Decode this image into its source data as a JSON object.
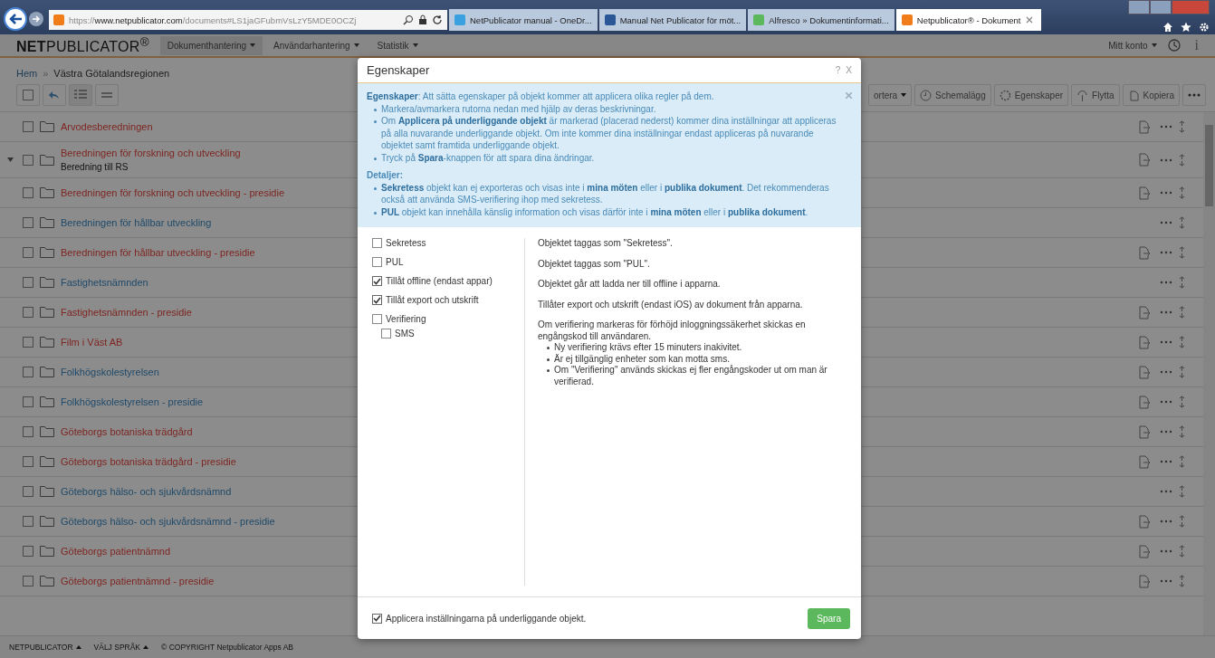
{
  "browser": {
    "address": {
      "scheme": "https://",
      "domain": "www.netpublicator.com",
      "path": "/documents#LS1jaGFubmVsLzY5MDE0OCZj"
    },
    "tabs": [
      {
        "title": "NetPublicator manual - OneDr...",
        "kind": "globe",
        "selected": false
      },
      {
        "title": "Manual Net Publicator för möt...",
        "kind": "word",
        "selected": false
      },
      {
        "title": "Alfresco » Dokumentinformati...",
        "kind": "flower",
        "selected": false
      },
      {
        "title": "Netpublicator® - Dokument",
        "kind": "site",
        "selected": true
      }
    ]
  },
  "nav": {
    "logo": "**NET**PUBLICATOR$^{®}$",
    "menu": [
      {
        "label": "Dokumenthantering",
        "selected": true
      },
      {
        "label": "Användarhantering",
        "selected": false
      },
      {
        "label": "Statistik",
        "selected": false
      }
    ],
    "account": "Mitt konto",
    "info": "i"
  },
  "breadcrumb": {
    "home": "Hem",
    "separator": "»",
    "current": "Västra Götalandsregionen"
  },
  "toolbar": [
    {
      "label": "ortera",
      "kind": "dropdown"
    },
    {
      "label": "Schemalägg",
      "kind": "clock"
    },
    {
      "label": "Egenskaper",
      "kind": "gear"
    },
    {
      "label": "Flytta",
      "kind": "move"
    },
    {
      "label": "Kopiera",
      "kind": "copy"
    }
  ],
  "rows": [
    {
      "title": "Arvodesberedningen",
      "color": "#7e2622",
      "checked": false,
      "expanded": false,
      "document_icon": true
    },
    {
      "title": "Beredningen för forskning och utveckling",
      "subtitle": "Beredning till RS",
      "color": "#7e2622",
      "checked": false,
      "expanded": true,
      "document_icon": true
    },
    {
      "title": "Beredningen för forskning och utveckling - presidie",
      "color": "#7e2622",
      "checked": false,
      "expanded": false,
      "document_icon": true
    },
    {
      "title": "Beredningen för hållbar utveckling",
      "color": "#1f4a6a",
      "checked": false,
      "expanded": false,
      "document_icon": false
    },
    {
      "title": "Beredningen för hållbar utveckling - presidie",
      "color": "#7e2622",
      "checked": false,
      "expanded": false,
      "document_icon": true
    },
    {
      "title": "Fastighetsnämnden",
      "color": "#1f4a6a",
      "checked": false,
      "expanded": false,
      "document_icon": false
    },
    {
      "title": "Fastighetsnämnden - presidie",
      "color": "#7e2622",
      "checked": false,
      "expanded": false,
      "document_icon": true
    },
    {
      "title": "Film i Väst AB",
      "color": "#7e2622",
      "checked": false,
      "expanded": false,
      "document_icon": true
    },
    {
      "title": "Folkhögskolestyrelsen",
      "color": "#1f4a6a",
      "checked": false,
      "expanded": false,
      "document_icon": true
    },
    {
      "title": "Folkhögskolestyrelsen - presidie",
      "color": "#1f4a6a",
      "checked": false,
      "expanded": false,
      "document_icon": true
    },
    {
      "title": "Göteborgs botaniska trädgård",
      "color": "#7e2622",
      "checked": false,
      "expanded": false,
      "document_icon": true
    },
    {
      "title": "Göteborgs botaniska trädgård - presidie",
      "color": "#7e2622",
      "checked": false,
      "expanded": false,
      "document_icon": true
    },
    {
      "title": "Göteborgs hälso- och sjukvårdsnämnd",
      "color": "#1f4a6a",
      "checked": false,
      "expanded": false,
      "document_icon": false
    },
    {
      "title": "Göteborgs hälso- och sjukvårdsnämnd - presidie",
      "color": "#1f4a6a",
      "checked": false,
      "expanded": false,
      "document_icon": true
    },
    {
      "title": "Göteborgs patientnämnd",
      "color": "#7e2622",
      "checked": false,
      "expanded": false,
      "document_icon": true
    },
    {
      "title": "Göteborgs patientnämnd - presidie",
      "color": "#7e2622",
      "checked": false,
      "expanded": false,
      "document_icon": true
    }
  ],
  "footer": [
    {
      "label": "NETPUBLICATOR",
      "menu": true
    },
    {
      "label": "VÄLJ SPRÅK",
      "menu": true
    },
    {
      "label": "© COPYRIGHT Netpublicator Apps AB",
      "menu": false
    }
  ],
  "dialog": {
    "title": "Egenskaper",
    "help": "?",
    "close": "X",
    "info": {
      "lead": "**Egenskaper**: Att sätta egenskaper på objekt kommer att applicera olika regler på dem.",
      "bullets": [
        "Markera/avmarkera rutorna nedan med hjälp av deras beskrivningar.",
        "Om **Applicera på underliggande objekt** är markerad (placerad nederst) kommer dina inställningar att appliceras på alla nuvarande underliggande objekt. Om inte kommer dina inställningar endast appliceras på nuvarande objektet samt framtida underliggande objekt.",
        "Tryck på **Spara**-knappen för att spara dina ändringar."
      ],
      "details_title": "Detaljer:",
      "details": [
        "**Sekretess** objekt kan ej exporteras och visas inte i **mina möten** eller i **publika dokument**. Det rekommenderas också att använda SMS-verifiering ihop med sekretess.",
        "**PUL** objekt kan innehålla känslig information och visas därför inte i **mina möten** eller i **publika dokument**."
      ]
    },
    "options": [
      {
        "label": "Sekretess",
        "checked": false,
        "description": "Objektet taggas som \"Sekretess\"."
      },
      {
        "label": "PUL",
        "checked": false,
        "description": "Objektet taggas som \"PUL\"."
      },
      {
        "label": "Tillåt offline (endast appar)",
        "checked": true,
        "description": "Objektet går att ladda ner till offline i apparna."
      },
      {
        "label": "Tillåt export och utskrift",
        "checked": true,
        "description": "Tillåter export och utskrift (endast iOS) av dokument från apparna."
      },
      {
        "label": "Verifiering",
        "checked": false,
        "description": "Om verifiering markeras för förhöjd inloggningssäkerhet skickas en engångskod till användaren.",
        "notes": [
          "Ny verifiering krävs efter 15 minuters inakivitet.",
          "Är ej tillgänglig enheter som kan motta sms.",
          "Om \"Verifiering\" används skickas ej fler engångskoder ut om man är verifierad."
        ],
        "children": [
          {
            "label": "SMS",
            "checked": false
          }
        ]
      }
    ],
    "apply": {
      "label": "Applicera inställningarna på underliggande objekt.",
      "checked": true
    },
    "save": "Spara"
  }
}
